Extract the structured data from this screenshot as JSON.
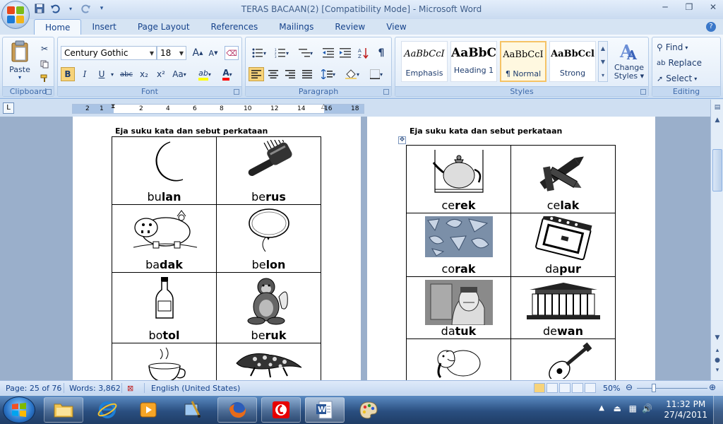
{
  "window": {
    "title": "TERAS BACAAN(2) [Compatibility Mode] - Microsoft Word",
    "minimize": "─",
    "restore": "❐",
    "close": "✕",
    "help": "?"
  },
  "qat": {
    "save_icon": "floppy-disk-icon",
    "undo_icon": "undo-icon",
    "redo_icon": "redo-icon"
  },
  "tabs": [
    "Home",
    "Insert",
    "Page Layout",
    "References",
    "Mailings",
    "Review",
    "View"
  ],
  "clipboard": {
    "paste": "Paste",
    "label": "Clipboard"
  },
  "font": {
    "name": "Century Gothic",
    "size": "18",
    "label": "Font",
    "grow": "A",
    "shrink": "A",
    "bold": "B",
    "italic": "I",
    "underline": "U",
    "strike": "abc",
    "sub": "x₂",
    "sup": "x²",
    "case": "Aa",
    "highlight": "ab",
    "color": "A"
  },
  "paragraph": {
    "label": "Paragraph",
    "pilcrow": "¶"
  },
  "styles": {
    "label": "Styles",
    "items": [
      {
        "sample": "AaBbCcI",
        "name": "Emphasis"
      },
      {
        "sample": "AaBbC(",
        "name": "Heading 1"
      },
      {
        "sample": "AaBbCcI",
        "name": "¶ Normal"
      },
      {
        "sample": "AaBbCcl",
        "name": "Strong"
      }
    ],
    "change_styles_1": "Change",
    "change_styles_2": "Styles"
  },
  "editing": {
    "label": "Editing",
    "find": "Find",
    "replace": "Replace",
    "select": "Select"
  },
  "ruler": {
    "numbers": [
      "2",
      "1",
      "2",
      "4",
      "6",
      "8",
      "10",
      "12",
      "14",
      "16",
      "18"
    ],
    "corner": "L"
  },
  "document": {
    "left_heading": "Eja suku kata dan sebut perkataan",
    "right_heading": "Eja suku kata dan sebut perkataan",
    "left_cells": [
      {
        "a": "bu",
        "b": "lan",
        "icon": "moon-icon"
      },
      {
        "a": "be",
        "b": "rus",
        "icon": "hairbrush-icon"
      },
      {
        "a": "ba",
        "b": "dak",
        "icon": "rhinoceros-icon"
      },
      {
        "a": "be",
        "b": "lon",
        "icon": "balloon-icon"
      },
      {
        "a": "bo",
        "b": "tol",
        "icon": "bottle-icon"
      },
      {
        "a": "be",
        "b": "ruk",
        "icon": "monkey-icon"
      },
      {
        "a": "",
        "b": "",
        "icon": "teacup-icon"
      },
      {
        "a": "",
        "b": "",
        "icon": "lizard-icon"
      }
    ],
    "right_cells": [
      {
        "a": "ce",
        "b": "rek",
        "icon": "teapot-icon"
      },
      {
        "a": "ce",
        "b": "lak",
        "icon": "crayons-icon"
      },
      {
        "a": "co",
        "b": "rak",
        "icon": "pattern-icon"
      },
      {
        "a": "da",
        "b": "pur",
        "icon": "stove-icon"
      },
      {
        "a": "da",
        "b": "tuk",
        "icon": "grandfather-icon"
      },
      {
        "a": "de",
        "b": "wan",
        "icon": "hall-building-icon"
      },
      {
        "a": "",
        "b": "",
        "icon": "elephant-icon"
      },
      {
        "a": "",
        "b": "",
        "icon": "guitar-icon"
      }
    ]
  },
  "status": {
    "page": "Page: 25 of 76",
    "words": "Words: 3,862",
    "language": "English (United States)",
    "zoom": "50%"
  },
  "taskbar": {
    "time": "11:32 PM",
    "date": "27/4/2011"
  }
}
